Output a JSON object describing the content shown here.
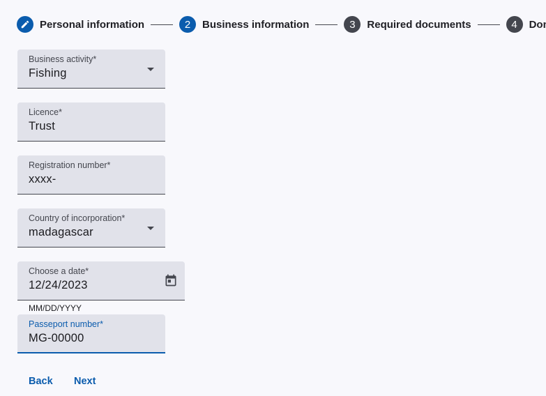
{
  "stepper": {
    "steps": [
      {
        "label": "Personal information",
        "marker": "pencil-icon",
        "state": "edit"
      },
      {
        "label": "Business information",
        "marker": "2",
        "state": "active"
      },
      {
        "label": "Required documents",
        "marker": "3",
        "state": "pending"
      },
      {
        "label": "Done",
        "marker": "4",
        "state": "pending"
      }
    ]
  },
  "form": {
    "business_activity": {
      "label": "Business activity*",
      "value": "Fishing"
    },
    "licence": {
      "label": "Licence*",
      "value": "Trust"
    },
    "registration_number": {
      "label": "Registration number*",
      "value": "xxxx-"
    },
    "country": {
      "label": "Country of incorporation*",
      "value": "madagascar"
    },
    "date": {
      "label": "Choose a date*",
      "value": "12/24/2023",
      "hint": "MM/DD/YYYY"
    },
    "passport": {
      "label": "Passeport number*",
      "value": "MG-00000"
    }
  },
  "actions": {
    "back_label": "Back",
    "next_label": "Next"
  },
  "colors": {
    "primary": "#0b5cad",
    "step_pending": "#44464e",
    "field_bg": "#e1e2ea",
    "page_bg": "#f8f8fc"
  }
}
